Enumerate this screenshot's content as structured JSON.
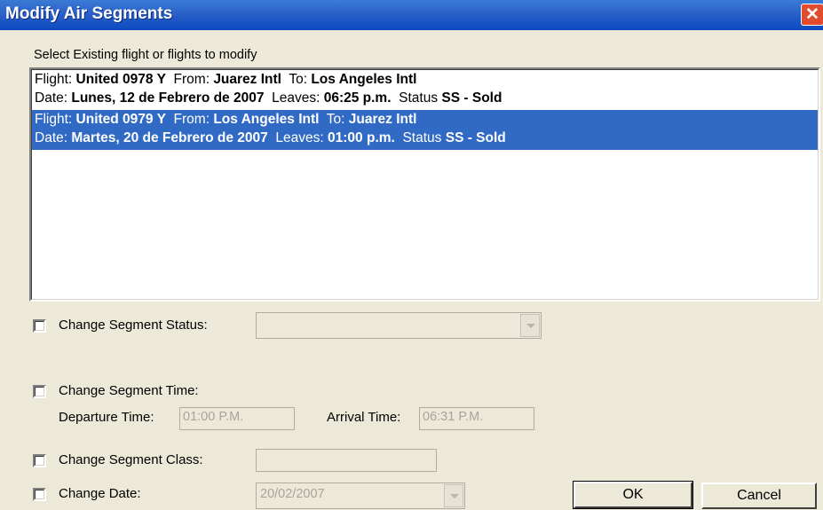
{
  "window": {
    "title": "Modify Air Segments",
    "close_glyph": "✕"
  },
  "list_label": "Select Existing flight or flights to modify",
  "flights": [
    {
      "flight_label": "Flight:",
      "flight": "United 0978 Y",
      "from_label": "From:",
      "from": "Juarez Intl",
      "to_label": "To:",
      "to": "Los Angeles Intl",
      "date_label": "Date:",
      "date": "Lunes, 12 de Febrero de 2007",
      "leaves_label": "Leaves:",
      "leaves": "06:25 p.m.",
      "status_label": "Status",
      "status": "SS - Sold",
      "selected": false
    },
    {
      "flight_label": "Flight:",
      "flight": "United 0979 Y",
      "from_label": "From:",
      "from": "Los Angeles Intl",
      "to_label": "To:",
      "to": "Juarez Intl",
      "date_label": "Date:",
      "date": "Martes, 20 de Febrero de 2007",
      "leaves_label": "Leaves:",
      "leaves": "01:00 p.m.",
      "status_label": "Status",
      "status": "SS - Sold",
      "selected": true
    }
  ],
  "change_status": {
    "label": "Change Segment Status:",
    "checked": false,
    "value": ""
  },
  "change_time": {
    "label": "Change Segment Time:",
    "checked": false,
    "departure_label": "Departure Time:",
    "departure_value": "01:00 P.M.",
    "arrival_label": "Arrival Time:",
    "arrival_value": "06:31 P.M."
  },
  "change_class": {
    "label": "Change Segment Class:",
    "checked": false,
    "value": ""
  },
  "change_date": {
    "label": "Change Date:",
    "checked": false,
    "value": "20/02/2007"
  },
  "buttons": {
    "ok": "OK",
    "cancel": "Cancel"
  },
  "colors": {
    "selection": "#316ac5",
    "titlebar": "#2a60c8",
    "close": "#e24b2d",
    "face": "#ece9d8"
  }
}
